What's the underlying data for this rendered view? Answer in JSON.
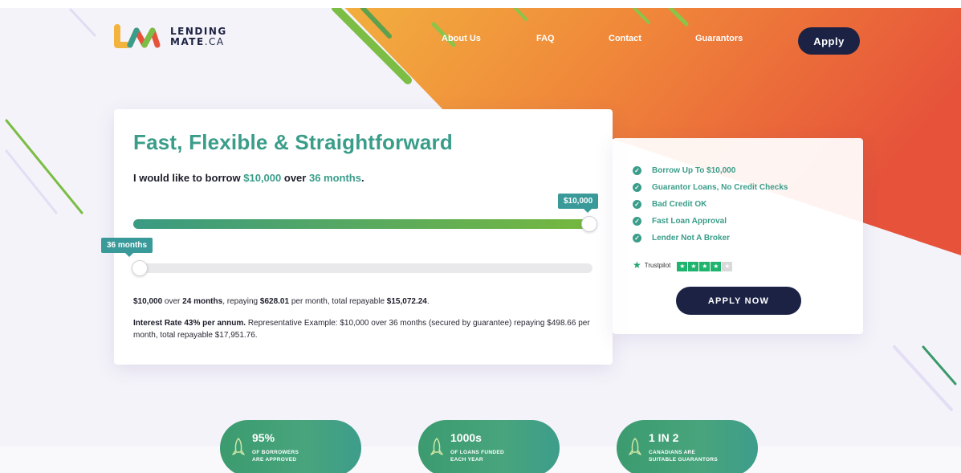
{
  "header": {
    "logo_line1": "LENDING",
    "logo_line2": "MATE",
    "logo_suffix": ".CA",
    "nav": [
      "About Us",
      "FAQ",
      "Contact",
      "Guarantors"
    ],
    "apply_label": "Apply"
  },
  "calculator": {
    "title": "Fast, Flexible & Straightforward",
    "borrow_prefix": "I would like to borrow",
    "amount": "$10,000",
    "borrow_mid": "over",
    "term": "36 months",
    "period": ".",
    "amount_tip": "$10,000",
    "term_tip": "36 months",
    "amount_slider_fraction": 1.0,
    "term_slider_fraction": 0.0,
    "summary": {
      "amount": "$10,000",
      "t1": " over ",
      "term": "24 months",
      "t2": ", repaying ",
      "monthly": "$628.01",
      "t3": " per month, total repayable ",
      "total": "$15,072.24",
      "t4": "."
    },
    "interest": {
      "rate": "Interest Rate 43% per annum.",
      "text": " Representative Example: $10,000 over 36 months (secured by guarantee) repaying $498.66 per month, total repayable $17,951.76."
    }
  },
  "features": {
    "items": [
      "Borrow Up To $10,000",
      "Guarantor Loans, No Credit Checks",
      "Bad Credit OK",
      "Fast Loan Approval",
      "Lender Not A Broker"
    ],
    "trustpilot_label": "Trustpilot",
    "trustpilot_stars": 4,
    "apply_now_label": "APPLY NOW"
  },
  "stats": [
    {
      "big": "95%",
      "line1": "OF BORROWERS",
      "line2": "ARE APPROVED"
    },
    {
      "big": "1000s",
      "line1": "OF LOANS FUNDED",
      "line2": "EACH YEAR"
    },
    {
      "big": "1 IN 2",
      "line1": "CANADIANS ARE",
      "line2": "SUITABLE GUARANTORS"
    }
  ],
  "colors": {
    "brand_green": "#3a9d8a",
    "navy": "#1b2244",
    "orange_start": "#f0a53a",
    "orange_end": "#e8533a"
  }
}
